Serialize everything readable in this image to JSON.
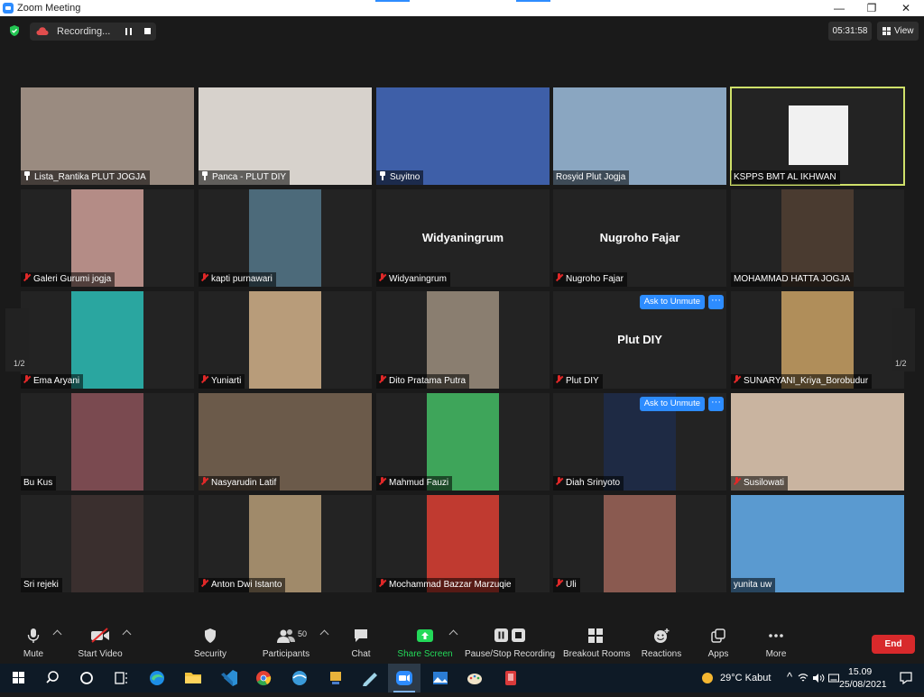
{
  "window": {
    "title": "Zoom Meeting",
    "minimize": "—",
    "maximize": "❐",
    "close": "✕"
  },
  "topbar": {
    "recording_label": "Recording...",
    "timer": "05:31:58",
    "view_label": "View"
  },
  "tiles": [
    {
      "name": "Lista_Rantika PLUT JOGJA",
      "status": "pin",
      "bg": "#9a8b80"
    },
    {
      "name": "Panca - PLUT DIY",
      "status": "pin",
      "bg": "#d7d2cc"
    },
    {
      "name": "Suyitno",
      "status": "pin",
      "bg": "#3e5fa8"
    },
    {
      "name": "Rosyid Plut Jogja",
      "status": "none",
      "bg": "#8aa6c1"
    },
    {
      "name": "KSPPS BMT AL IKHWAN",
      "status": "none",
      "bg": "#f1f1f1"
    },
    {
      "name": "Galeri Gurumi jogja",
      "status": "muted",
      "bg": "#b48c86"
    },
    {
      "name": "kapti purnawari",
      "status": "muted",
      "bg": "#4c6a7a"
    },
    {
      "name": "Widyaningrum",
      "status": "muted",
      "big_name": "Widyaningrum"
    },
    {
      "name": "Nugroho Fajar",
      "status": "muted",
      "big_name": "Nugroho Fajar"
    },
    {
      "name": "MOHAMMAD HATTA  JOGJA",
      "status": "none",
      "bg": "#4a3b30"
    },
    {
      "name": "Ema Aryani",
      "status": "muted",
      "bg": "#2aa6a0"
    },
    {
      "name": "Yuniarti",
      "status": "muted",
      "bg": "#b89c7a"
    },
    {
      "name": "Dito Pratama Putra",
      "status": "muted",
      "bg": "#8a7e70"
    },
    {
      "name": "Plut DIY",
      "status": "muted",
      "big_name": "Plut DIY",
      "ask_unmute": "Ask to Unmute"
    },
    {
      "name": "SUNARYANI_Kriya_Borobudur",
      "status": "muted",
      "bg": "#b08e5a"
    },
    {
      "name": "Bu Kus",
      "status": "none",
      "bg": "#7a4a50"
    },
    {
      "name": "Nasyarudin Latif",
      "status": "muted",
      "bg": "#6b5a4a"
    },
    {
      "name": "Mahmud Fauzi",
      "status": "muted",
      "bg": "#3ea55a"
    },
    {
      "name": "Diah Srinyoto",
      "status": "muted",
      "bg": "#1e2a44",
      "ask_unmute": "Ask to Unmute"
    },
    {
      "name": "Susilowati",
      "status": "muted",
      "bg": "#c9b4a0"
    },
    {
      "name": "Sri rejeki",
      "status": "none",
      "bg": "#3a2f2e"
    },
    {
      "name": "Anton Dwi Istanto",
      "status": "muted",
      "bg": "#a08a6a"
    },
    {
      "name": "Mochammad Bazzar Marzuqie",
      "status": "muted",
      "bg": "#c03a30"
    },
    {
      "name": "Uli",
      "status": "muted",
      "bg": "#8a5a50"
    },
    {
      "name": "yunita uw",
      "status": "none",
      "bg": "#5a9ad0"
    }
  ],
  "pager": {
    "left_label": "1/2",
    "right_label": "1/2"
  },
  "toolbar": {
    "mute": "Mute",
    "start_video": "Start Video",
    "security": "Security",
    "participants": "Participants",
    "participants_count": "50",
    "chat": "Chat",
    "share_screen": "Share Screen",
    "pause_stop_recording": "Pause/Stop Recording",
    "breakout_rooms": "Breakout Rooms",
    "reactions": "Reactions",
    "apps": "Apps",
    "more": "More",
    "end": "End"
  },
  "taskbar": {
    "weather": "29°C  Kabut",
    "time": "15.09",
    "date": "25/08/2021"
  },
  "colors": {
    "accent": "#2d8cff",
    "end": "#d8292b",
    "share_green": "#23d959",
    "active_speaker": "#cfe06a"
  }
}
